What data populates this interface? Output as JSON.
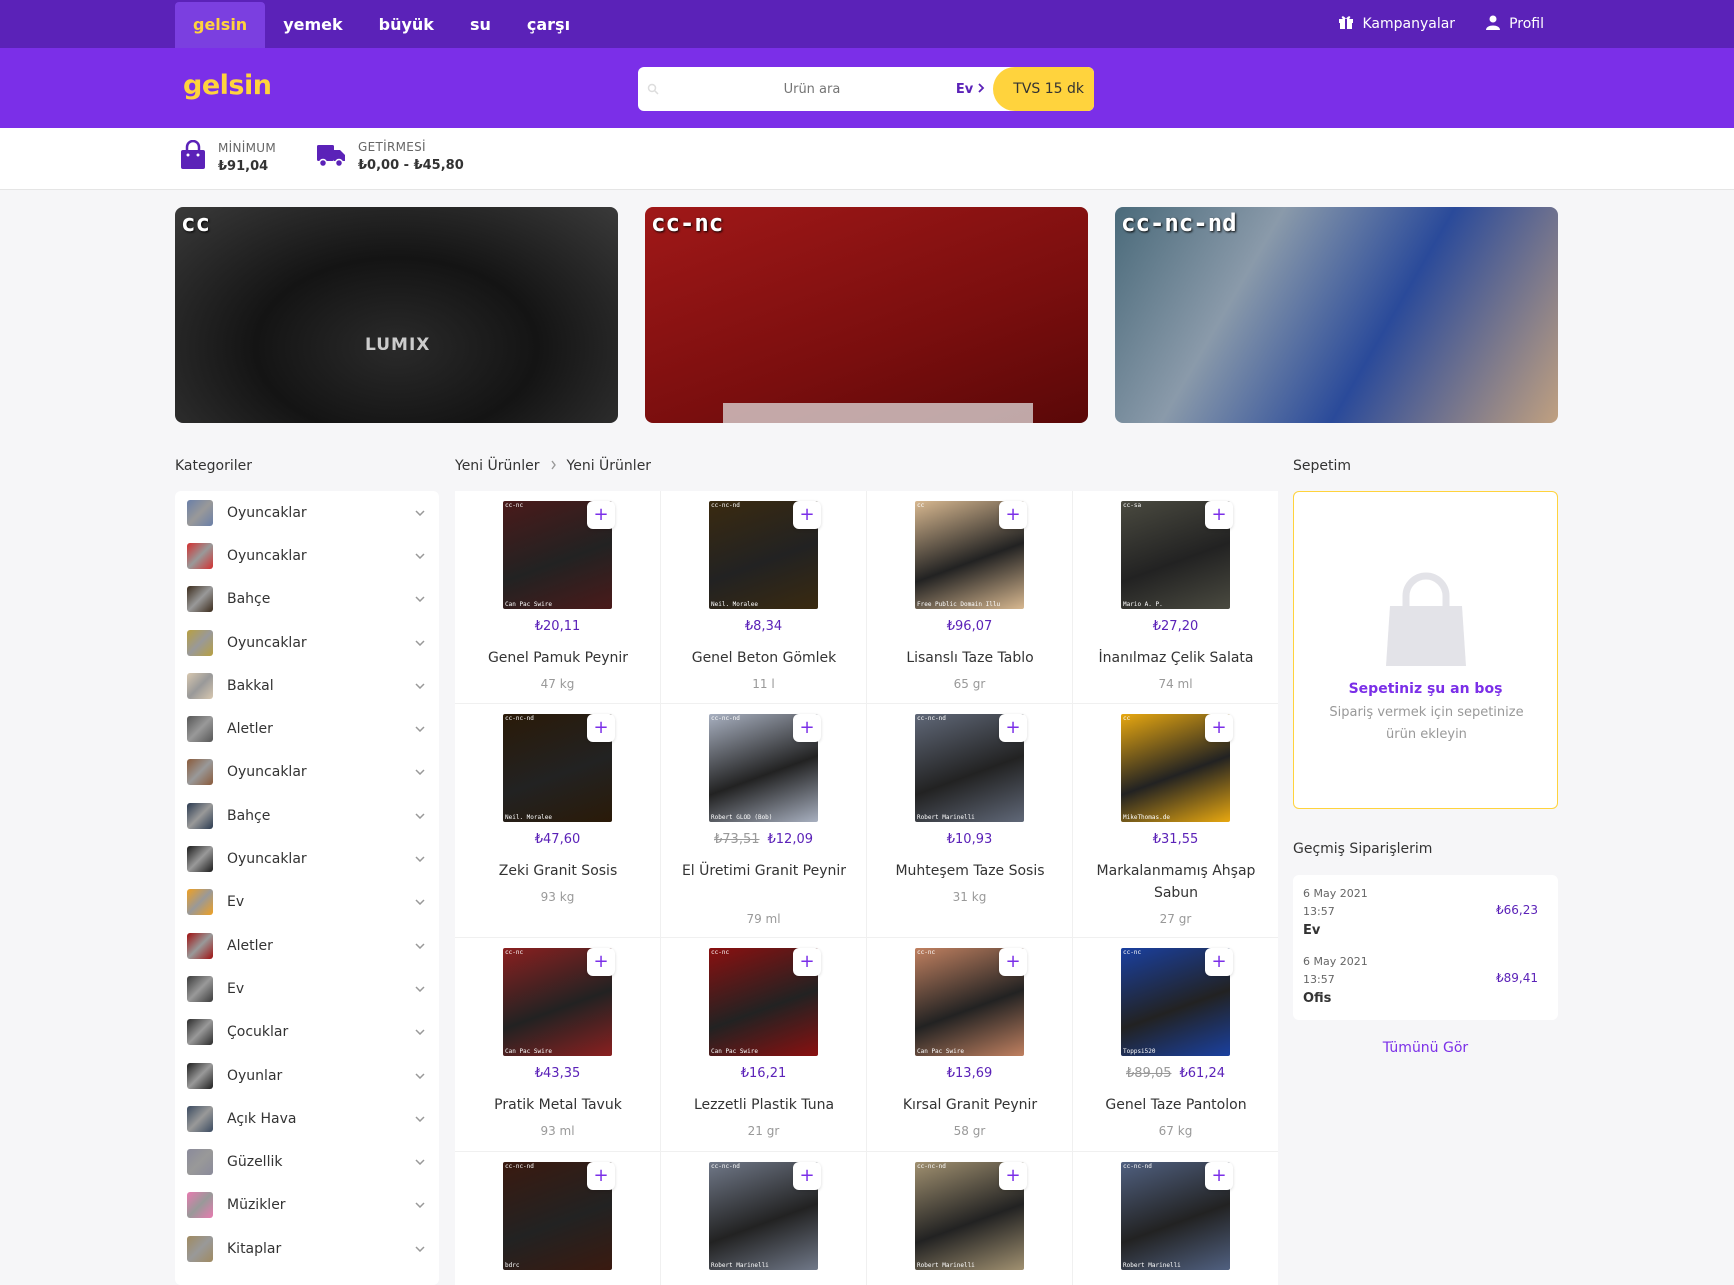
{
  "topnav": {
    "tabs": [
      "gelsin",
      "yemek",
      "büyük",
      "su",
      "çarşı"
    ],
    "campaigns_label": "Kampanyalar",
    "profile_label": "Profil"
  },
  "brand": {
    "logo": "gelsin"
  },
  "search": {
    "placeholder": "Ürün ara",
    "address": "Ev",
    "eta": "TVS 15 dk"
  },
  "info": {
    "minimum_label": "MİNİMUM",
    "minimum_value": "₺91,04",
    "delivery_label": "GETİRMESİ",
    "delivery_value": "₺0,00 - ₺45,80"
  },
  "banners": [
    "cc",
    "cc-nc",
    "cc-nc-nd"
  ],
  "banner1_text": "LUMIX",
  "sections": {
    "categories_title": "Kategoriler",
    "breadcrumb_1": "Yeni Ürünler",
    "breadcrumb_2": "Yeni Ürünler",
    "cart_title": "Sepetim",
    "orders_title": "Geçmiş Siparişlerim"
  },
  "categories": [
    {
      "name": "Oyuncaklar",
      "color": "#6a7fa8"
    },
    {
      "name": "Oyuncaklar",
      "color": "#d32f2f"
    },
    {
      "name": "Bahçe",
      "color": "#3a2a1a"
    },
    {
      "name": "Oyuncaklar",
      "color": "#b8a040"
    },
    {
      "name": "Bakkal",
      "color": "#d8c8b0"
    },
    {
      "name": "Aletler",
      "color": "#555555"
    },
    {
      "name": "Oyuncaklar",
      "color": "#8a5a3a"
    },
    {
      "name": "Bahçe",
      "color": "#2a3a50"
    },
    {
      "name": "Oyuncaklar",
      "color": "#1a1a1a"
    },
    {
      "name": "Ev",
      "color": "#f0a020"
    },
    {
      "name": "Aletler",
      "color": "#a01010"
    },
    {
      "name": "Ev",
      "color": "#3a3a3a"
    },
    {
      "name": "Çocuklar",
      "color": "#2a2a2a"
    },
    {
      "name": "Oyunlar",
      "color": "#1e1e1e"
    },
    {
      "name": "Açık Hava",
      "color": "#3a4a60"
    },
    {
      "name": "Güzellik",
      "color": "#8a8a9a"
    },
    {
      "name": "Müzikler",
      "color": "#e87ab0"
    },
    {
      "name": "Kitaplar",
      "color": "#a08a60"
    }
  ],
  "products": [
    {
      "price": "₺20,11",
      "old": "",
      "name": "Genel Pamuk Peynir",
      "unit": "47 kg",
      "lic": "cc-nc",
      "cred": "Can Pac Swire",
      "color": "#4a1a1a"
    },
    {
      "price": "₺8,34",
      "old": "",
      "name": "Genel Beton Gömlek",
      "unit": "11 l",
      "lic": "cc-nc-nd",
      "cred": "Neil. Moralee",
      "color": "#3a2a10"
    },
    {
      "price": "₺96,07",
      "old": "",
      "name": "Lisanslı Taze Tablo",
      "unit": "65 gr",
      "lic": "cc",
      "cred": "Free Public Domain Illu",
      "color": "#d8b890"
    },
    {
      "price": "₺27,20",
      "old": "",
      "name": "İnanılmaz Çelik Salata",
      "unit": "74 ml",
      "lic": "cc-sa",
      "cred": "Mario A. P.",
      "color": "#4a4a40"
    },
    {
      "price": "₺47,60",
      "old": "",
      "name": "Zeki Granit Sosis",
      "unit": "93 kg",
      "lic": "cc-nc-nd",
      "cred": "Neil. Moralee",
      "color": "#2a1a08"
    },
    {
      "price": "₺12,09",
      "old": "₺73,51",
      "name": "El Üretimi Granit Peynir",
      "unit": "79 ml",
      "lic": "cc-nc-nd",
      "cred": "Robert GLOD (Bob)",
      "color": "#a8b0c0"
    },
    {
      "price": "₺10,93",
      "old": "",
      "name": "Muhteşem Taze Sosis",
      "unit": "31 kg",
      "lic": "cc-nc-nd",
      "cred": "Robert Marinelli",
      "color": "#606878"
    },
    {
      "price": "₺31,55",
      "old": "",
      "name": "Markalanmamış Ahşap Sabun",
      "unit": "27 gr",
      "lic": "cc",
      "cred": "MikeThomas.de",
      "color": "#e8a810"
    },
    {
      "price": "₺43,35",
      "old": "",
      "name": "Pratik Metal Tavuk",
      "unit": "93 ml",
      "lic": "cc-nc",
      "cred": "Can Pac Swire",
      "color": "#8a2020"
    },
    {
      "price": "₺16,21",
      "old": "",
      "name": "Lezzetli Plastik Tuna",
      "unit": "21 gr",
      "lic": "cc-nc",
      "cred": "Can Pac Swire",
      "color": "#8a1010"
    },
    {
      "price": "₺13,69",
      "old": "",
      "name": "Kırsal Granit Peynir",
      "unit": "58 gr",
      "lic": "cc-nc",
      "cred": "Can Pac Swire",
      "color": "#c08060"
    },
    {
      "price": "₺61,24",
      "old": "₺89,05",
      "name": "Genel Taze Pantolon",
      "unit": "67 kg",
      "lic": "cc-nc",
      "cred": "Toppsi520",
      "color": "#1a40a0"
    },
    {
      "price": "",
      "old": "",
      "name": "",
      "unit": "",
      "lic": "cc-nc-nd",
      "cred": "bdrc",
      "color": "#3a1a10"
    },
    {
      "price": "",
      "old": "",
      "name": "",
      "unit": "",
      "lic": "cc-nc-nd",
      "cred": "Robert Marinelli",
      "color": "#707888"
    },
    {
      "price": "",
      "old": "",
      "name": "",
      "unit": "",
      "lic": "cc-nc-nd",
      "cred": "Robert Marinelli",
      "color": "#a09070"
    },
    {
      "price": "",
      "old": "",
      "name": "",
      "unit": "",
      "lic": "cc-nc-nd",
      "cred": "Robert Marinelli",
      "color": "#506080"
    }
  ],
  "cart": {
    "empty_title": "Sepetiniz şu an boş",
    "empty_sub": "Sipariş vermek için sepetinize ürün ekleyin"
  },
  "orders": [
    {
      "date": "6 May 2021",
      "time": "13:57",
      "address": "Ev",
      "amount": "₺66,23"
    },
    {
      "date": "6 May 2021",
      "time": "13:57",
      "address": "Ofis",
      "amount": "₺89,41"
    }
  ],
  "see_all": "Tümünü Gör"
}
